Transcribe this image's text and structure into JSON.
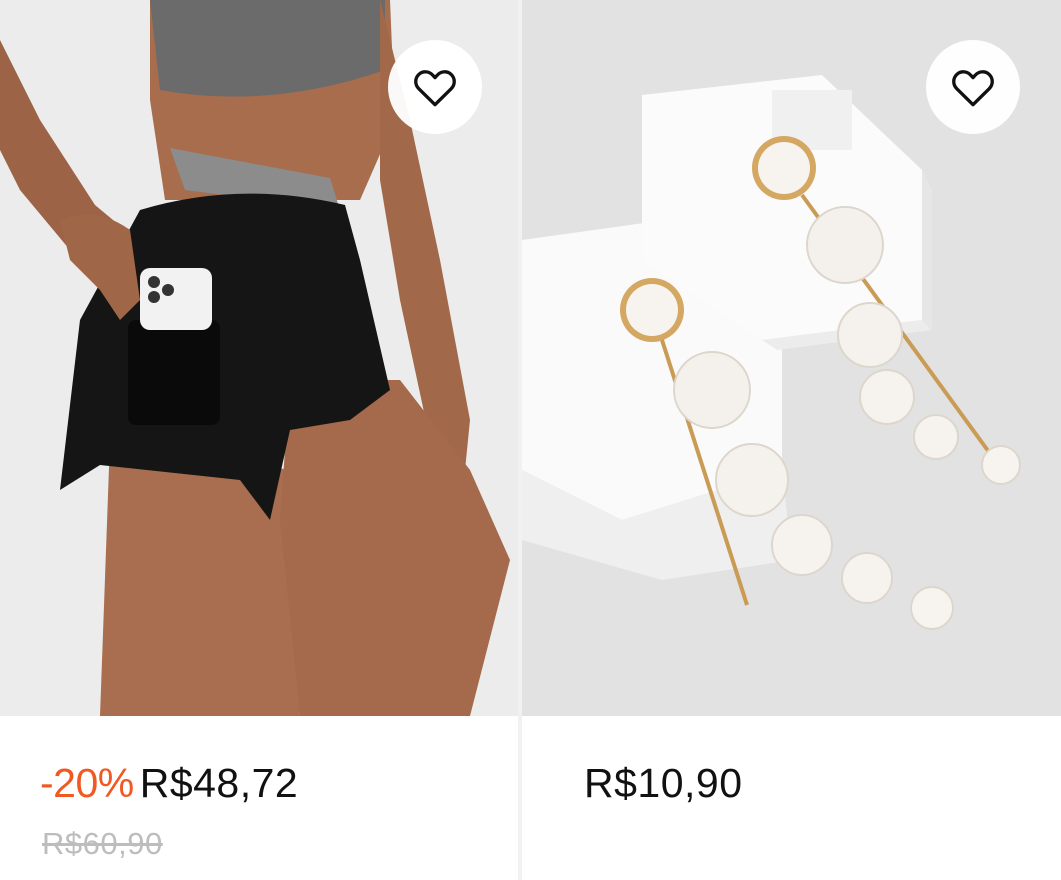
{
  "products": [
    {
      "image_alt": "black athletic shorts with phone pocket",
      "discount": "-20%",
      "price": "R$48,72",
      "original_price": "R$60,90",
      "favorite_icon": "heart-outline-icon"
    },
    {
      "image_alt": "pearl drop earrings",
      "price": "R$10,90",
      "favorite_icon": "heart-outline-icon"
    }
  ],
  "colors": {
    "discount": "#f05a22",
    "price": "#111111",
    "original_price": "#bdbdbd"
  }
}
